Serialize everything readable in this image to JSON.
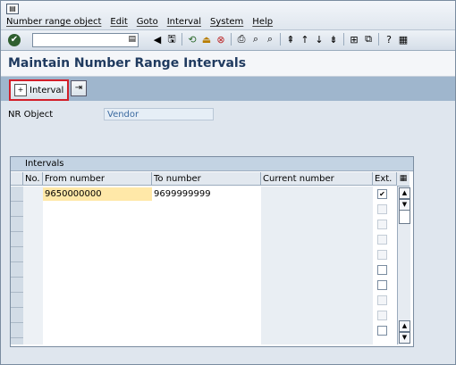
{
  "menu": {
    "items": [
      "Number range object",
      "Edit",
      "Goto",
      "Interval",
      "System",
      "Help"
    ]
  },
  "toolbar": {
    "command_value": ""
  },
  "page": {
    "title": "Maintain Number Range Intervals"
  },
  "app_toolbar": {
    "interval_label": "Interval"
  },
  "nr_object": {
    "label": "NR Object",
    "value": "Vendor"
  },
  "intervals": {
    "title": "Intervals",
    "columns": [
      "No.",
      "From number",
      "To number",
      "Current number",
      "Ext."
    ],
    "rows": [
      {
        "no": "",
        "from": "9650000000",
        "to": "9699999999",
        "current": "",
        "ext": true
      }
    ]
  },
  "colors": {
    "highlight_box": "#d21f2a",
    "title_text": "#1f3a5f",
    "app_toolbar_bg": "#9fb6cd",
    "selected_cell": "#ffe8a8"
  }
}
